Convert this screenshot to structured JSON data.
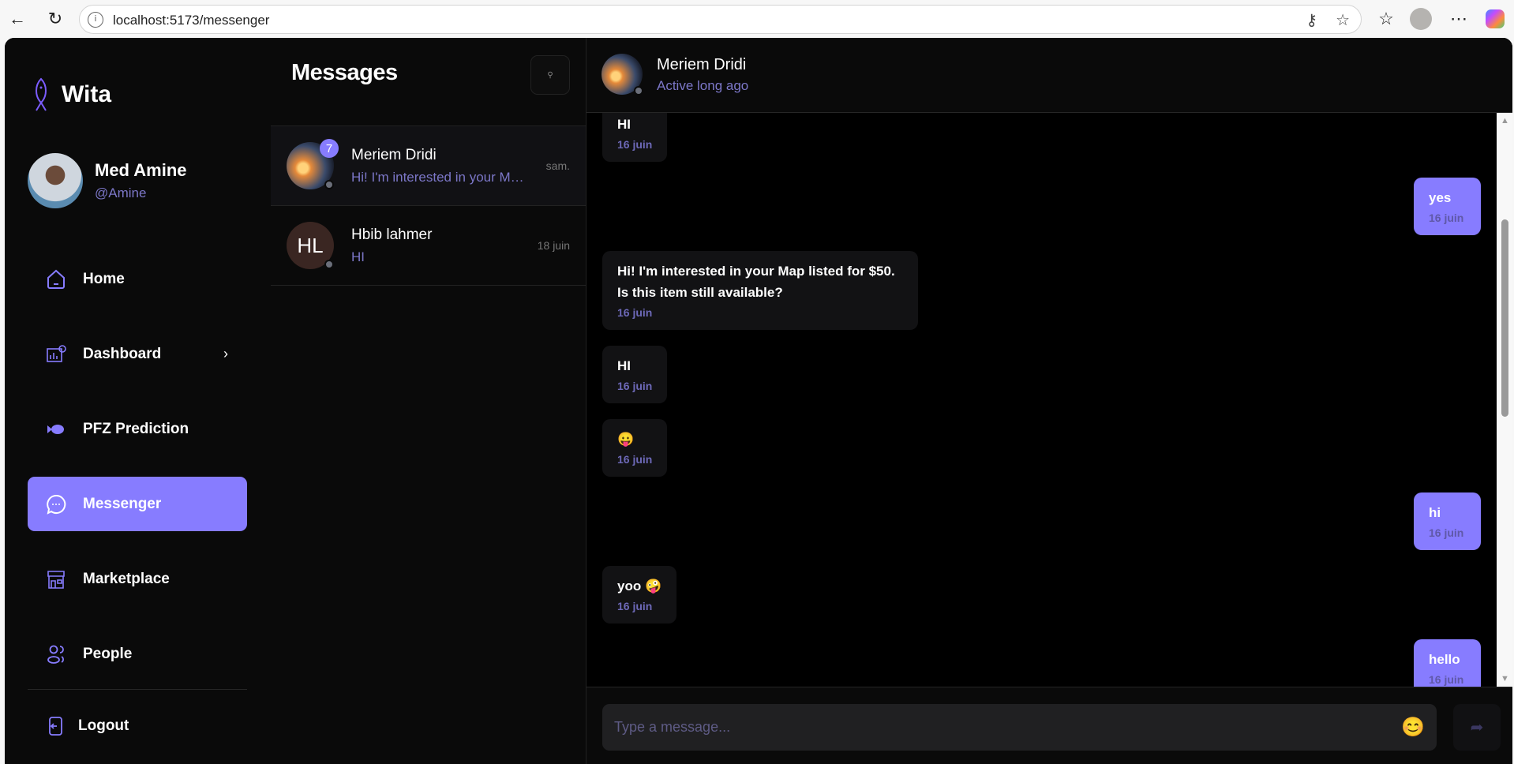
{
  "browser": {
    "url": "localhost:5173/messenger"
  },
  "brand": {
    "name": "Wita",
    "accent": "#877cff"
  },
  "user": {
    "name": "Med Amine",
    "handle": "@Amine"
  },
  "nav": [
    {
      "label": "Home",
      "icon": "home-icon"
    },
    {
      "label": "Dashboard",
      "icon": "dashboard-icon"
    },
    {
      "label": "PFZ Prediction",
      "icon": "fish-icon"
    },
    {
      "label": "Messenger",
      "icon": "chat-icon",
      "active": true
    },
    {
      "label": "Marketplace",
      "icon": "store-icon"
    },
    {
      "label": "People",
      "icon": "people-icon"
    }
  ],
  "logout": "Logout",
  "conversations": {
    "title": "Messages",
    "search_icon": "search-icon",
    "items": [
      {
        "name": "Meriem Dridi",
        "preview": "Hi! I'm interested in your Map listed for $50. Is this item still available?",
        "time": "sam.",
        "unread": "7"
      },
      {
        "name": "Hbib lahmer",
        "initials": "HL",
        "preview": "HI",
        "time": "18 juin"
      }
    ]
  },
  "chat": {
    "name": "Meriem Dridi",
    "status": "Active long ago",
    "messages": [
      {
        "dir": "in",
        "text": "HI",
        "date": "16 juin"
      },
      {
        "dir": "out",
        "text": "yes",
        "date": "16 juin"
      },
      {
        "dir": "in",
        "text": "Hi! I'm interested in your Map listed for $50. Is this item still available?",
        "date": "16 juin"
      },
      {
        "dir": "in",
        "text": "HI",
        "date": "16 juin"
      },
      {
        "dir": "in",
        "text": "😛",
        "date": "16 juin"
      },
      {
        "dir": "out",
        "text": "hi",
        "date": "16 juin"
      },
      {
        "dir": "in",
        "text": "yoo 🤪",
        "date": "16 juin"
      },
      {
        "dir": "out",
        "text": "hello",
        "date": "16 juin"
      }
    ],
    "input_placeholder": "Type a message...",
    "emoji_button": "😊"
  }
}
